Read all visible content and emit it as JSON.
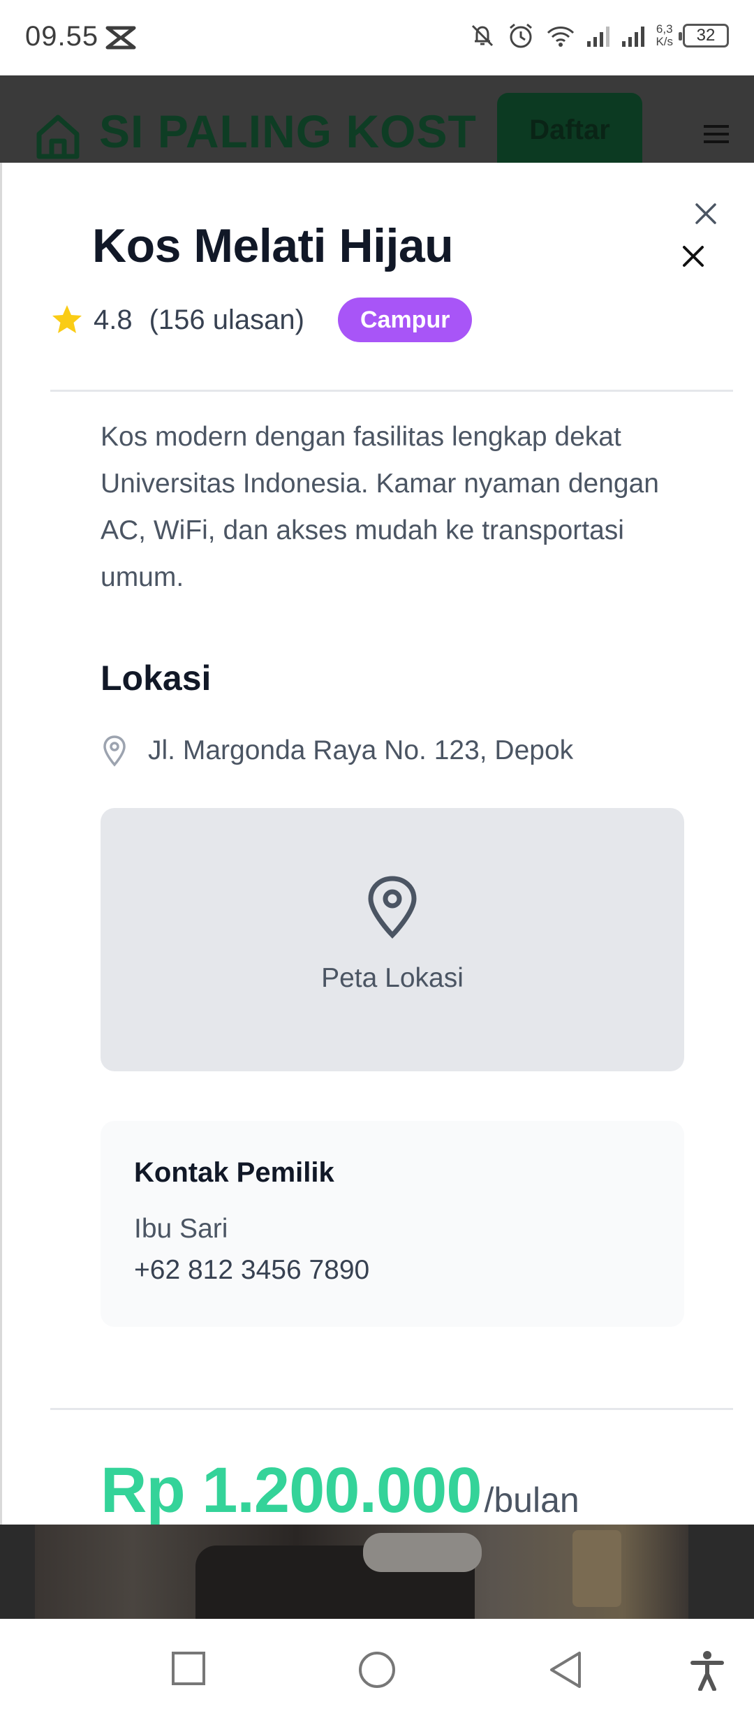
{
  "status_bar": {
    "time": "09.55",
    "net_speed_value": "6,3",
    "net_speed_unit": "K/s",
    "battery": "32"
  },
  "site_header": {
    "title": "SI PALING KOST",
    "register_label": "Daftar"
  },
  "listing": {
    "title": "Kos Melati Hijau",
    "rating": "4.8",
    "reviews": "(156 ulasan)",
    "type_badge": "Campur",
    "description": "Kos modern dengan fasilitas lengkap dekat Universitas Indonesia. Kamar nyaman dengan AC, WiFi, dan akses mudah ke transportasi umum.",
    "location_heading": "Lokasi",
    "address": "Jl. Margonda Raya No. 123, Depok",
    "map_label": "Peta Lokasi",
    "contact": {
      "heading": "Kontak Pemilik",
      "name": "Ibu Sari",
      "phone": "+62 812 3456 7890"
    },
    "price": "Rp 1.200.000",
    "price_unit": "/bulan"
  },
  "colors": {
    "badge": "#a855f7",
    "price": "#34d399",
    "star": "#facc15",
    "brand_green": "#0e3d24"
  }
}
